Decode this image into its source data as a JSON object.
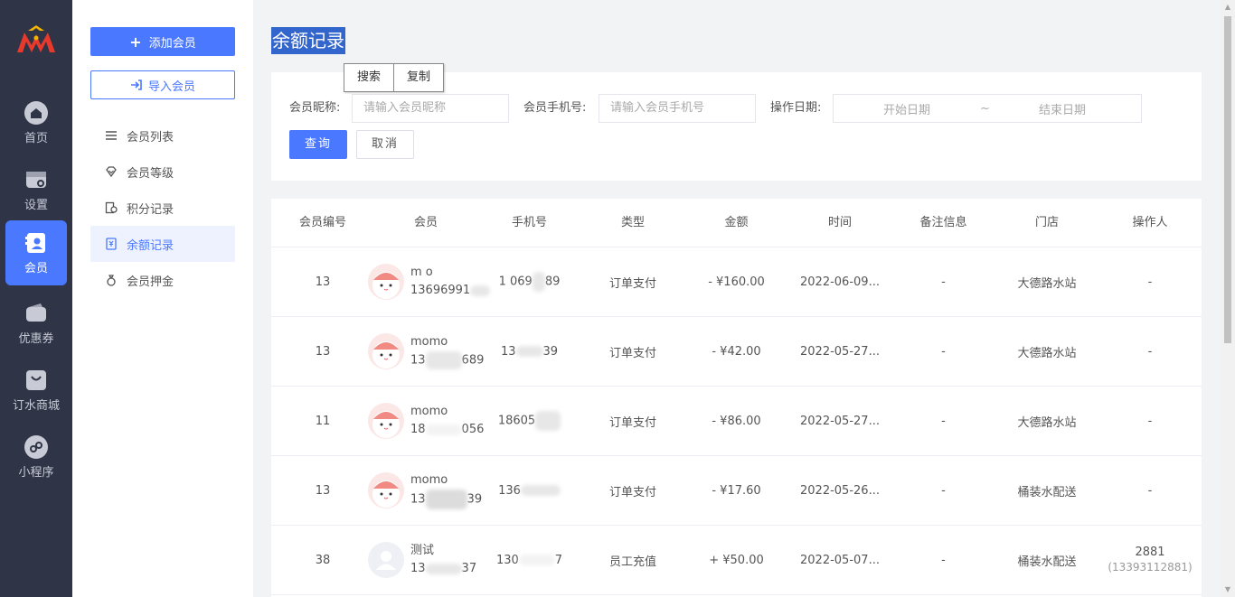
{
  "nav": {
    "items": [
      {
        "label": "首页",
        "icon": "home-icon"
      },
      {
        "label": "设置",
        "icon": "store-settings-icon"
      },
      {
        "label": "会员",
        "icon": "member-card-icon"
      },
      {
        "label": "优惠券",
        "icon": "wallet-icon"
      },
      {
        "label": "订水商城",
        "icon": "shop-bag-icon"
      },
      {
        "label": "小程序",
        "icon": "miniprogram-icon"
      }
    ],
    "active_index": 2
  },
  "sidebar": {
    "add_label": "添加会员",
    "import_label": "导入会员",
    "items": [
      {
        "label": "会员列表"
      },
      {
        "label": "会员等级"
      },
      {
        "label": "积分记录"
      },
      {
        "label": "余额记录"
      },
      {
        "label": "会员押金"
      }
    ],
    "active_index": 3
  },
  "page": {
    "title": "余额记录"
  },
  "context_menu": {
    "items": [
      "搜索",
      "复制"
    ]
  },
  "filter": {
    "nickname_label": "会员昵称:",
    "nickname_placeholder": "请输入会员昵称",
    "phone_label": "会员手机号:",
    "phone_placeholder": "请输入会员手机号",
    "date_label": "操作日期:",
    "start_placeholder": "开始日期",
    "range_sep": "~",
    "end_placeholder": "结束日期",
    "query_label": "查询",
    "cancel_label": "取消"
  },
  "table": {
    "headers": [
      "会员编号",
      "会员",
      "手机号",
      "类型",
      "金额",
      "时间",
      "备注信息",
      "门店",
      "操作人"
    ],
    "rows": [
      {
        "id": "13",
        "name": "m   o",
        "member_phone": "13696991",
        "phone": "1  069",
        "phone_tail": "89",
        "type": "订单支付",
        "amount": "- ¥160.00",
        "time": "2022-06-09...",
        "note": "-",
        "store": "大德路水站",
        "operator": "-",
        "operator_sub": ""
      },
      {
        "id": "13",
        "name": "momo",
        "member_phone": "13",
        "member_phone_tail": "689",
        "phone": "13",
        "phone_tail": "39",
        "type": "订单支付",
        "amount": "- ¥42.00",
        "time": "2022-05-27...",
        "note": "-",
        "store": "大德路水站",
        "operator": "-",
        "operator_sub": ""
      },
      {
        "id": "11",
        "name": "momo",
        "member_phone": "18",
        "member_phone_tail": "056",
        "phone": "18605",
        "phone_tail": "",
        "type": "订单支付",
        "amount": "- ¥86.00",
        "time": "2022-05-27...",
        "note": "-",
        "store": "大德路水站",
        "operator": "-",
        "operator_sub": ""
      },
      {
        "id": "13",
        "name": "momo",
        "member_phone": "13",
        "member_phone_tail": "39",
        "phone": "136",
        "phone_tail": "",
        "type": "订单支付",
        "amount": "- ¥17.60",
        "time": "2022-05-26...",
        "note": "-",
        "store": "桶装水配送",
        "operator": "-",
        "operator_sub": ""
      },
      {
        "id": "38",
        "name": "测试",
        "member_phone": "13",
        "member_phone_tail": "37",
        "phone": "130",
        "phone_tail": "7",
        "type": "员工充值",
        "amount": "+ ¥50.00",
        "time": "2022-05-07...",
        "note": "-",
        "store": "桶装水配送",
        "operator": "2881",
        "operator_sub": "(13393112881)"
      }
    ]
  },
  "colors": {
    "accent": "#4a78ff",
    "rail_bg": "#2f3447",
    "title_highlight": "#3366cc"
  }
}
